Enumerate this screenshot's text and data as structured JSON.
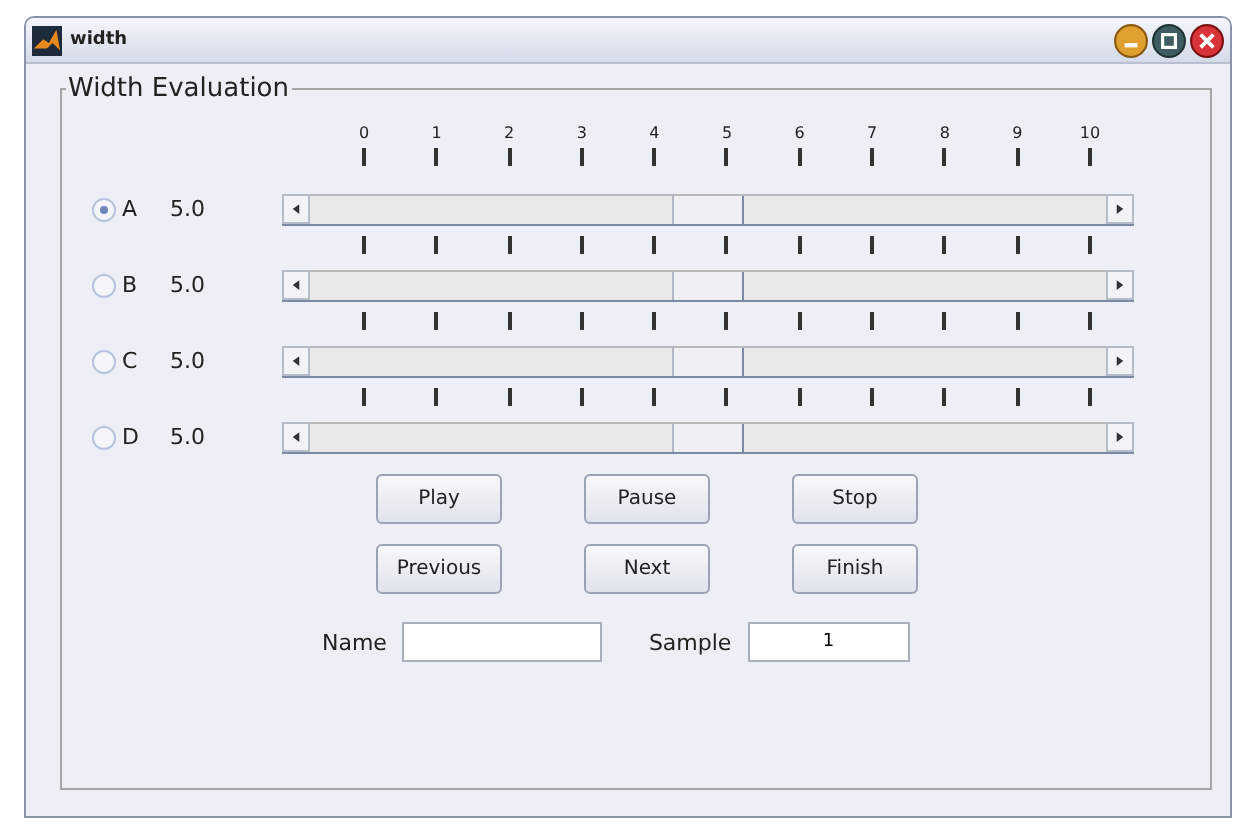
{
  "window": {
    "title": "width"
  },
  "panel": {
    "title": "Width Evaluation"
  },
  "scale": [
    "0",
    "1",
    "2",
    "3",
    "4",
    "5",
    "6",
    "7",
    "8",
    "9",
    "10"
  ],
  "sliders": [
    {
      "label": "A",
      "selected": true,
      "value": "5.0",
      "level": 0.5
    },
    {
      "label": "B",
      "selected": false,
      "value": "5.0",
      "level": 0.5
    },
    {
      "label": "C",
      "selected": false,
      "value": "5.0",
      "level": 0.5
    },
    {
      "label": "D",
      "selected": false,
      "value": "5.0",
      "level": 0.5
    }
  ],
  "button_rows": [
    [
      "Play",
      "Pause",
      "Stop"
    ],
    [
      "Previous",
      "Next",
      "Finish"
    ]
  ],
  "name_field": {
    "label": "Name"
  },
  "sample_field": {
    "label": "Sample",
    "value": "1"
  }
}
